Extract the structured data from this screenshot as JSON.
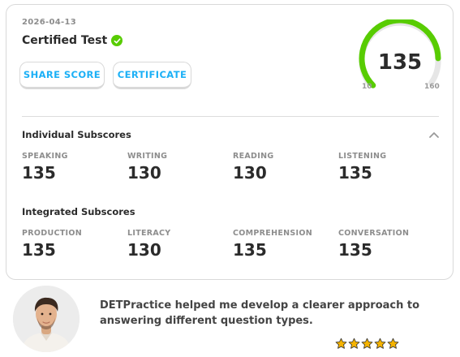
{
  "result": {
    "date": "2026-04-13",
    "title": "Certified Test",
    "share_label": "SHARE SCORE",
    "certificate_label": "CERTIFICATE",
    "overall_score": "135",
    "gauge_min": "10",
    "gauge_max": "160",
    "gauge_fraction": 0.833
  },
  "individual": {
    "title": "Individual Subscores",
    "items": [
      {
        "label": "SPEAKING",
        "value": "135"
      },
      {
        "label": "WRITING",
        "value": "130"
      },
      {
        "label": "READING",
        "value": "130"
      },
      {
        "label": "LISTENING",
        "value": "135"
      }
    ]
  },
  "integrated": {
    "title": "Integrated Subscores",
    "items": [
      {
        "label": "PRODUCTION",
        "value": "135"
      },
      {
        "label": "LITERACY",
        "value": "130"
      },
      {
        "label": "COMPREHENSION",
        "value": "135"
      },
      {
        "label": "CONVERSATION",
        "value": "135"
      }
    ]
  },
  "testimonial": {
    "quote": "DETPractice helped me develop a clearer approach to answering different question types.",
    "rating": 5
  },
  "colors": {
    "accent_green": "#58cc02",
    "accent_blue": "#1cb0f6",
    "star_gold": "#f5b301"
  },
  "icons": {
    "verified": "check-circle-icon",
    "collapse": "chevron-up-icon",
    "rating": "star-icon"
  }
}
